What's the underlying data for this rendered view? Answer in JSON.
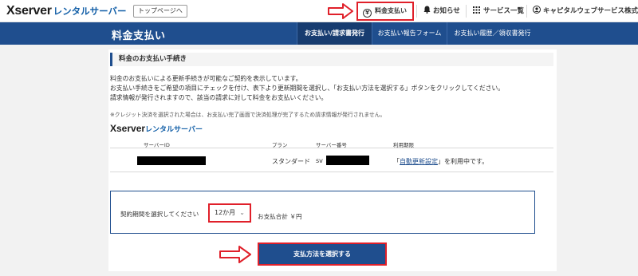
{
  "header": {
    "logo_main": "Xserver",
    "logo_sub": "レンタルサーバー",
    "top_page_button": "トップページへ",
    "nav": {
      "payment": "料金支払い",
      "payment_icon": "¥",
      "notice": "お知らせ",
      "services": "サービス一覧",
      "account": "キャピタルウェブサービス株式..."
    }
  },
  "titlebar": {
    "title": "料金支払い",
    "tabs": [
      "お支払い/請求書発行",
      "お支払い報告フォーム",
      "お支払い履歴／領収書発行"
    ]
  },
  "main": {
    "section_title": "料金のお支払い手続き",
    "desc": [
      "料金のお支払いによる更新手続きが可能なご契約を表示しています。",
      "お支払い手続きをご希望の項目にチェックを付け、表下より更新期間を選択し、「お支払い方法を選択する」ボタンをクリックしてください。",
      "請求情報が発行されますので、該当の請求に対して料金をお支払いください。"
    ],
    "note": "※クレジット決済を選択された場合は、お支払い完了画面で決済処理が完了するため請求情報が発行されません。",
    "product_logo_main": "Xserver",
    "product_logo_sub": "レンタルサーバー",
    "table": {
      "headers": [
        "サーバーID",
        "プラン",
        "サーバー番号",
        "利用期限"
      ],
      "row": {
        "plan": "スタンダード",
        "server_prefix": "sv",
        "expiry_link": "自動更新設定",
        "expiry_prefix": "「",
        "expiry_suffix": "」を利用中です。"
      }
    },
    "period": {
      "label": "契約期間を選択してください",
      "selected": "12か月",
      "total": "お支払合計 ￥円"
    },
    "submit": "支払方法を選択する"
  },
  "colors": {
    "brand_blue": "#1f4e8e",
    "highlight_red": "#e0202a"
  }
}
